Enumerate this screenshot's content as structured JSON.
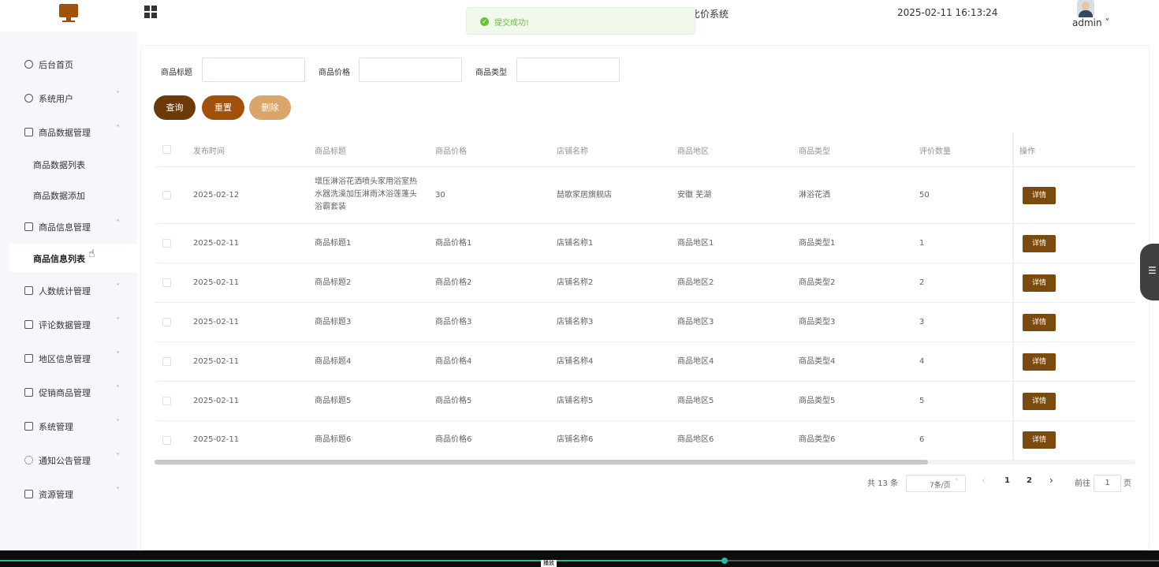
{
  "header": {
    "title_fragment": "比价系统",
    "datetime": "2025-02-11 16:13:24",
    "user": "admin ˅"
  },
  "toast": {
    "message": "提交成功!"
  },
  "sidebar": {
    "items": [
      {
        "label": "后台首页",
        "icon": "clock-icon",
        "chevron": ""
      },
      {
        "label": "系统用户",
        "icon": "user-icon",
        "chevron": "˅"
      },
      {
        "label": "商品数据管理",
        "icon": "doc-icon",
        "chevron": "˄",
        "children": [
          "商品数据列表",
          "商品数据添加"
        ]
      },
      {
        "label": "商品信息管理",
        "icon": "doc-icon",
        "chevron": "˄",
        "children": [
          "商品信息列表"
        ]
      },
      {
        "label": "人数统计管理",
        "icon": "doc-icon",
        "chevron": "˅"
      },
      {
        "label": "评论数据管理",
        "icon": "doc-icon",
        "chevron": "˅"
      },
      {
        "label": "地区信息管理",
        "icon": "doc-icon",
        "chevron": "˅"
      },
      {
        "label": "促销商品管理",
        "icon": "doc-icon",
        "chevron": "˅"
      },
      {
        "label": "系统管理",
        "icon": "folder-icon",
        "chevron": "˅"
      },
      {
        "label": "通知公告管理",
        "icon": "loading-icon",
        "chevron": "˅"
      },
      {
        "label": "资源管理",
        "icon": "ticket-icon",
        "chevron": "˅"
      }
    ]
  },
  "filters": {
    "title_label": "商品标题",
    "price_label": "商品价格",
    "type_label": "商品类型",
    "title_value": "",
    "price_value": "",
    "type_value": ""
  },
  "buttons": {
    "query": "查询",
    "reset": "重置",
    "delete": "删除"
  },
  "table": {
    "columns": [
      "发布时间",
      "商品标题",
      "商品价格",
      "店铺名称",
      "商品地区",
      "商品类型",
      "评价数量",
      "操作"
    ],
    "rows": [
      [
        "2025-02-12",
        "增压淋浴花洒喷头家用浴室热水器洗澡加压淋雨沐浴莲蓬头浴霸套装",
        "30",
        "喆歌家居旗舰店",
        "安徽 芜湖",
        "淋浴花洒",
        "50"
      ],
      [
        "2025-02-11",
        "商品标题1",
        "商品价格1",
        "店铺名称1",
        "商品地区1",
        "商品类型1",
        "1"
      ],
      [
        "2025-02-11",
        "商品标题2",
        "商品价格2",
        "店铺名称2",
        "商品地区2",
        "商品类型2",
        "2"
      ],
      [
        "2025-02-11",
        "商品标题3",
        "商品价格3",
        "店铺名称3",
        "商品地区3",
        "商品类型3",
        "3"
      ],
      [
        "2025-02-11",
        "商品标题4",
        "商品价格4",
        "店铺名称4",
        "商品地区4",
        "商品类型4",
        "4"
      ],
      [
        "2025-02-11",
        "商品标题5",
        "商品价格5",
        "店铺名称5",
        "商品地区5",
        "商品类型5",
        "5"
      ],
      [
        "2025-02-11",
        "商品标题6",
        "商品价格6",
        "店铺名称6",
        "商品地区6",
        "商品类型6",
        "6"
      ]
    ],
    "action_label": "详情"
  },
  "pagination": {
    "total": "共 13 条",
    "page_size": "7条/页",
    "prev": "‹",
    "pages": [
      "1",
      "2"
    ],
    "next": "›",
    "goto_prefix": "前往",
    "goto_value": "1",
    "goto_suffix": "页"
  },
  "player": {
    "label": "播放",
    "progress": 0.625
  },
  "colors": {
    "brand": "#7a4a0f",
    "reset": "#a0520a",
    "delete": "#d9a56a",
    "toast": "#67c23a"
  }
}
